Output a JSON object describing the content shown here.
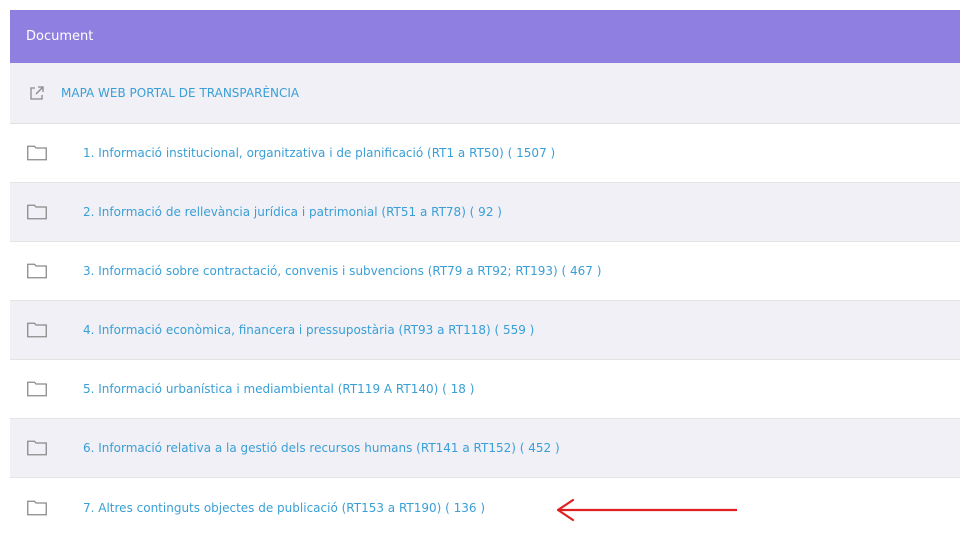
{
  "header": {
    "title": "Document",
    "color": "#8f7fe0"
  },
  "map_link": {
    "label": "MAPA WEB PORTAL DE TRANSPARÈNCIA",
    "icon": "external-link-icon"
  },
  "folders": [
    {
      "label": "1. Informació institucional, organitzativa i de planificació (RT1 a RT50) ( 1507 )",
      "icon": "folder-icon"
    },
    {
      "label": "2. Informació de rellevància jurídica i patrimonial (RT51 a RT78) ( 92 )",
      "icon": "folder-icon"
    },
    {
      "label": "3. Informació sobre contractació, convenis i subvencions (RT79 a RT92; RT193) ( 467 )",
      "icon": "folder-icon"
    },
    {
      "label": "4. Informació econòmica, financera i pressupostària (RT93 a RT118) ( 559 )",
      "icon": "folder-icon"
    },
    {
      "label": "5. Informació urbanística i mediambiental (RT119 A RT140) ( 18 )",
      "icon": "folder-icon"
    },
    {
      "label": "6. Informació relativa a la gestió dels recursos humans (RT141 a RT152) ( 452 )",
      "icon": "folder-icon"
    },
    {
      "label": "7. Altres continguts objectes de publicació (RT153 a RT190) ( 136 )",
      "icon": "folder-icon"
    }
  ],
  "annotation": {
    "icon": "red-arrow-icon",
    "color": "#e02020"
  }
}
